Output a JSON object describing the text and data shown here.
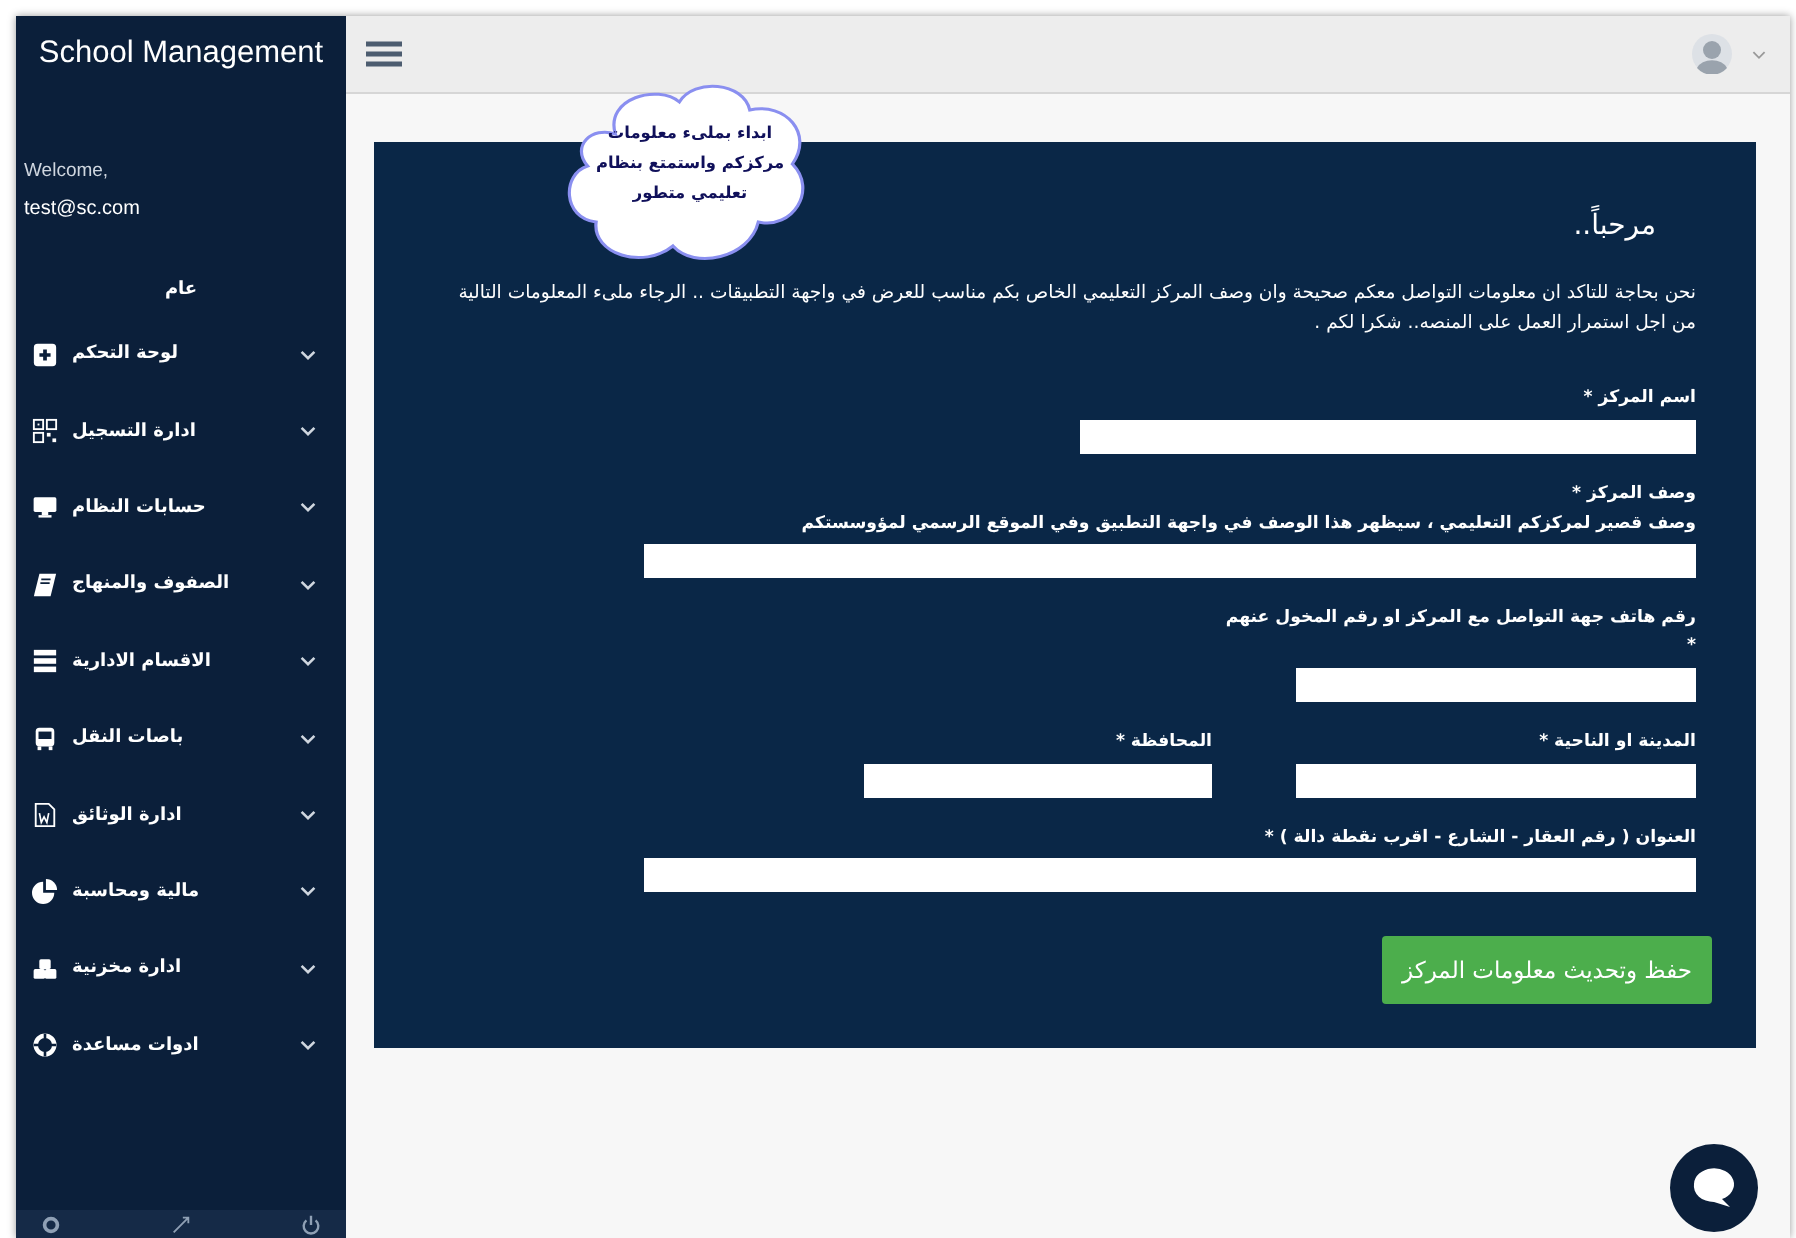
{
  "sidebar": {
    "brand": "School Management",
    "welcome": "Welcome,",
    "user": "test@sc.com",
    "section": "عام",
    "items": [
      {
        "label": "لوحة التحكم"
      },
      {
        "label": "ادارة التسجيل"
      },
      {
        "label": "حسابات النظام"
      },
      {
        "label": "الصفوف والمنهاج"
      },
      {
        "label": "الاقسام الادارية"
      },
      {
        "label": "باصات النقل"
      },
      {
        "label": "ادارة الوثائق"
      },
      {
        "label": "مالية ومحاسبة"
      },
      {
        "label": "ادارة مخزنية"
      },
      {
        "label": "ادوات مساعدة"
      }
    ]
  },
  "callout": "ابداء بملىء معلومات\nمركزكم واستمتع بنظام\nتعليمي متطور",
  "panel": {
    "title": "مرحباً..",
    "intro": "نحن بحاجة للتاكد ان معلومات التواصل معكم صحيحة وان وصف المركز التعليمي الخاص بكم مناسب للعرض في واجهة التطبيقات .. الرجاء ملىء المعلومات التالية من اجل استمرار العمل على المنصه.. شكرا لكم .",
    "rows": [
      {
        "fields": [
          {
            "label": "اسم المركز *"
          }
        ]
      },
      {
        "fields": [
          {
            "label": "وصف المركز *",
            "hint": "وصف قصير لمركزكم التعليمي ، سيظهر هذا الوصف في واجهة التطبيق وفي الموقع الرسمي لمؤوسستكم"
          }
        ]
      },
      {
        "fields": [
          {
            "label": "رقم هاتف جهة التواصل مع المركز او رقم المخول عنهم\n*"
          }
        ]
      },
      {
        "fields": [
          {
            "label": "المدينة او الناحية *"
          },
          {
            "label": "المحافظة *"
          }
        ]
      },
      {
        "fields": [
          {
            "label": "العنوان ( رقم العقار - الشارع - اقرب نقطة دالة ) *"
          }
        ]
      }
    ],
    "button": "حفظ وتحديث معلومات المركز"
  }
}
